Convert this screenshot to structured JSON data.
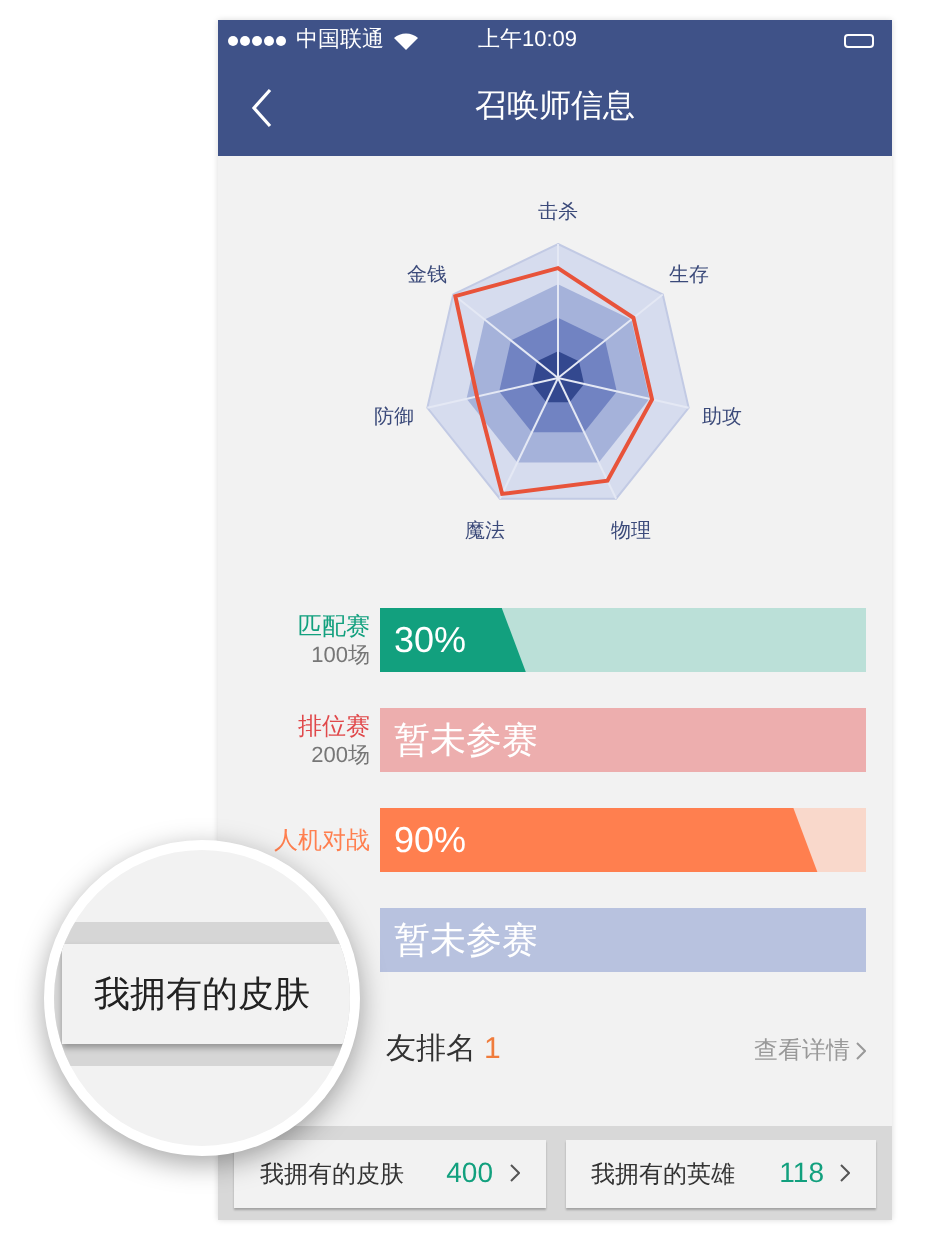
{
  "status_bar": {
    "carrier": "中国联通",
    "time": "上午10:09"
  },
  "nav": {
    "title": "召唤师信息"
  },
  "radar": {
    "axes": [
      "击杀",
      "生存",
      "助攻",
      "物理",
      "魔法",
      "防御",
      "金钱"
    ]
  },
  "modes": [
    {
      "kind": "percent",
      "label": "匹配赛",
      "count": "100场",
      "level": 0.3,
      "value": "30%",
      "color": "#12a07e"
    },
    {
      "kind": "none",
      "label": "排位赛",
      "count": "200场",
      "value": "暂未参赛",
      "color": "#e0484a"
    },
    {
      "kind": "percent",
      "label": "人机对战",
      "level": 0.9,
      "value": "90%",
      "color": "#ff7f4f"
    },
    {
      "kind": "none",
      "value": "暂未参赛"
    }
  ],
  "ranking": {
    "label": "友排名",
    "value": "1",
    "link": "查看详情"
  },
  "stats": [
    {
      "label": "我拥有的皮肤",
      "value": "400"
    },
    {
      "label": "我拥有的英雄",
      "value": "118"
    }
  ],
  "magnifier": {
    "label": "我拥有的皮肤"
  }
}
